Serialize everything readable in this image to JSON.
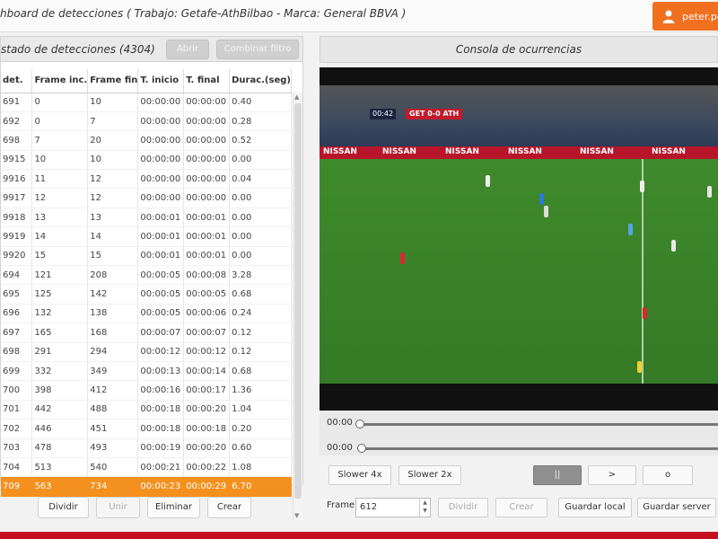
{
  "header": {
    "title": "hboard de detecciones ( Trabajo: Getafe-AthBilbao  -  Marca: General BBVA )",
    "user": "peter.po",
    "user_icon": "user-icon"
  },
  "left_panel": {
    "title": "stado de detecciones  (4304)",
    "btn_1": "Abrir",
    "btn_2": "Combinar filtro",
    "columns": [
      "det.",
      "Frame inc.",
      "Frame fin",
      "T. inicio",
      "T. final",
      "Durac.(seg)"
    ],
    "rows": [
      [
        "691",
        "0",
        "10",
        "00:00:00",
        "00:00:00",
        "0.40"
      ],
      [
        "692",
        "0",
        "7",
        "00:00:00",
        "00:00:00",
        "0.28"
      ],
      [
        "698",
        "7",
        "20",
        "00:00:00",
        "00:00:00",
        "0.52"
      ],
      [
        "9915",
        "10",
        "10",
        "00:00:00",
        "00:00:00",
        "0.00"
      ],
      [
        "9916",
        "11",
        "12",
        "00:00:00",
        "00:00:00",
        "0.04"
      ],
      [
        "9917",
        "12",
        "12",
        "00:00:00",
        "00:00:00",
        "0.00"
      ],
      [
        "9918",
        "13",
        "13",
        "00:00:01",
        "00:00:01",
        "0.00"
      ],
      [
        "9919",
        "14",
        "14",
        "00:00:01",
        "00:00:01",
        "0.00"
      ],
      [
        "9920",
        "15",
        "15",
        "00:00:01",
        "00:00:01",
        "0.00"
      ],
      [
        "694",
        "121",
        "208",
        "00:00:05",
        "00:00:08",
        "3.28"
      ],
      [
        "695",
        "125",
        "142",
        "00:00:05",
        "00:00:05",
        "0.68"
      ],
      [
        "696",
        "132",
        "138",
        "00:00:05",
        "00:00:06",
        "0.24"
      ],
      [
        "697",
        "165",
        "168",
        "00:00:07",
        "00:00:07",
        "0.12"
      ],
      [
        "698",
        "291",
        "294",
        "00:00:12",
        "00:00:12",
        "0.12"
      ],
      [
        "699",
        "332",
        "349",
        "00:00:13",
        "00:00:14",
        "0.68"
      ],
      [
        "700",
        "398",
        "412",
        "00:00:16",
        "00:00:17",
        "1.36"
      ],
      [
        "701",
        "442",
        "488",
        "00:00:18",
        "00:00:20",
        "1.04"
      ],
      [
        "702",
        "446",
        "451",
        "00:00:18",
        "00:00:18",
        "0.20"
      ],
      [
        "703",
        "478",
        "493",
        "00:00:19",
        "00:00:20",
        "0.60"
      ],
      [
        "704",
        "513",
        "540",
        "00:00:21",
        "00:00:22",
        "1.08"
      ],
      [
        "709",
        "563",
        "734",
        "00:00:23",
        "00:00:29",
        "6.70"
      ]
    ],
    "selected_row": 20,
    "buttons": [
      "Dividir",
      "Unir",
      "Eliminar",
      "Crear"
    ]
  },
  "right_panel": {
    "title": "Consola de ocurrencias",
    "video": {
      "scoreboard_time": "00:42",
      "scoreboard": "GET 0-0 ATH",
      "ad_text": [
        "NISSAN",
        "NISSAN",
        "NISSAN",
        "NISSAN",
        "NISSAN",
        "NISSAN"
      ]
    },
    "time_1": "00:00",
    "time_2": "00:00",
    "controls": {
      "slower4x": "Slower 4x",
      "slower2x": "Slower 2x",
      "pause": "||",
      "play": ">",
      "stop": "o",
      "frame_label": "Frame",
      "frame_value": "612",
      "btn_disabled_1": "Dividir",
      "btn_disabled_2": "Crear",
      "save_local": "Guardar local",
      "save_server": "Guardar server"
    }
  },
  "colors": {
    "accent": "#f07020",
    "selected_row": "#f4901e",
    "bottom_bar": "#c4101f"
  }
}
